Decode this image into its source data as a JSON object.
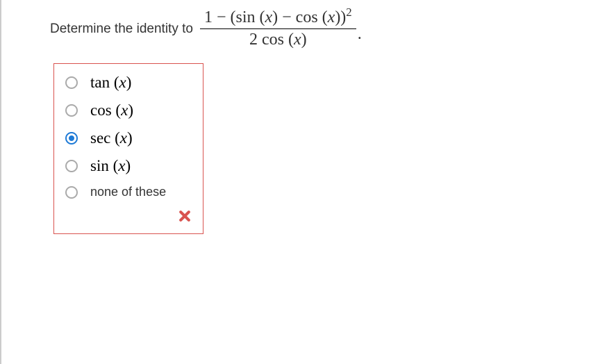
{
  "question": {
    "prompt": "Determine the identity to",
    "expression": {
      "numerator_prefix": "1 − (sin (",
      "numerator_var1": "x",
      "numerator_mid": ") − cos (",
      "numerator_var2": "x",
      "numerator_suffix": "))",
      "numerator_exp": "2",
      "denominator_prefix": "2 cos (",
      "denominator_var": "x",
      "denominator_suffix": ")"
    }
  },
  "options": [
    {
      "func": "tan",
      "var": "x",
      "selected": false,
      "plain": false
    },
    {
      "func": "cos",
      "var": "x",
      "selected": false,
      "plain": false
    },
    {
      "func": "sec",
      "var": "x",
      "selected": true,
      "plain": false
    },
    {
      "func": "sin",
      "var": "x",
      "selected": false,
      "plain": false
    },
    {
      "label": "none of these",
      "selected": false,
      "plain": true
    }
  ],
  "feedback": {
    "correct": false
  }
}
